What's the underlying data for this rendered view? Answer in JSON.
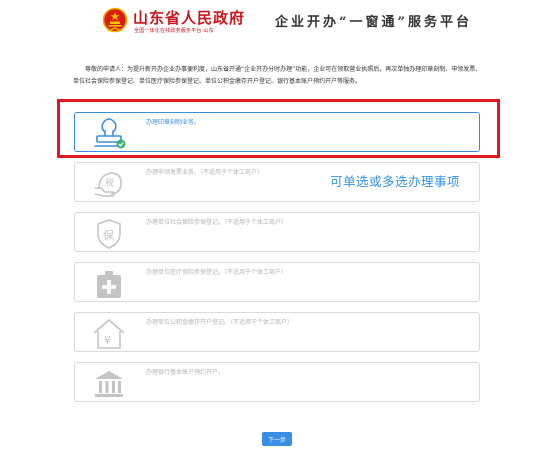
{
  "header": {
    "gov_title": "山东省人民政府",
    "gov_subtitle": "全国一体化在线政务服务平台·山东",
    "platform_title": "企业开办“一窗通”服务平台"
  },
  "intro": {
    "text": "尊敬的申请人：为提升新开办企业办事便利度，山东省开通“企业开办分时办理”功能，企业可在领取营业执照后，再次单独办理印章刻制、申领发票、单位社会保险参保登记、单位医疗保险参保登记、单位公积金缴存开户登记、银行基本账户预约开户等服务。"
  },
  "options": [
    {
      "label": "办理印章刻制业务。",
      "icon": "seal-stamp-icon",
      "selected": true
    },
    {
      "label": "办理申领发票业务。（不适用于个体工商户）",
      "icon": "tax-invoice-icon",
      "selected": false
    },
    {
      "label": "办理单位社会保险参保登记。（不适用于个体工商户）",
      "icon": "social-insurance-shield-icon",
      "selected": false
    },
    {
      "label": "办理单位医疗保险参保登记。（不适用于个体工商户）",
      "icon": "medical-kit-icon",
      "selected": false
    },
    {
      "label": "办理单位公积金缴存开户登记。（不适用于个体工商户）",
      "icon": "housing-fund-house-icon",
      "selected": false
    },
    {
      "label": "办理银行基本账户预约开户。",
      "icon": "bank-icon",
      "selected": false
    }
  ],
  "annotation": {
    "hint": "可单选或多选办理事项",
    "highlight_color": "#e2161c"
  },
  "footer": {
    "next_label": "下一步"
  },
  "colors": {
    "accent": "#3a8ee6",
    "brand_red": "#c8171d",
    "muted_icon": "#c4c4c4",
    "check_green": "#3cb371"
  }
}
